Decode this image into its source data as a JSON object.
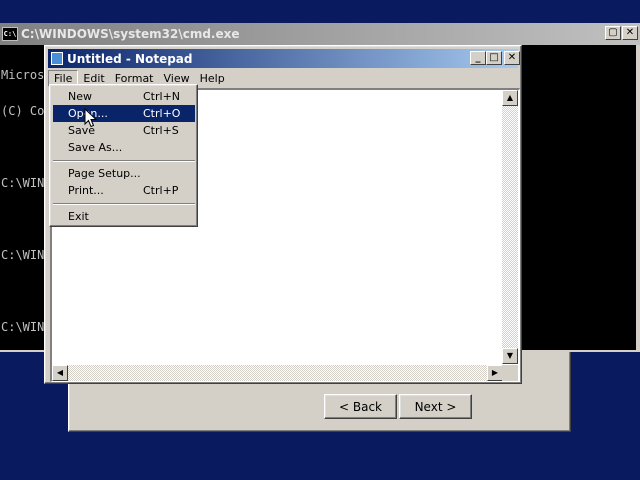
{
  "cmd_window": {
    "title": "C:\\WINDOWS\\system32\\cmd.exe",
    "icon": "cmd-icon",
    "icon_text": "C:\\",
    "console_lines": [
      "Micros",
      "(C) Co",
      "",
      "C:\\WIN",
      "",
      "C:\\WIN",
      "",
      "C:\\WIN"
    ]
  },
  "wizard": {
    "back_label": "< Back",
    "next_label": "Next >"
  },
  "notepad": {
    "title": "Untitled - Notepad",
    "menu": [
      "File",
      "Edit",
      "Format",
      "View",
      "Help"
    ],
    "content": ""
  },
  "file_menu": {
    "items": [
      {
        "label": "New",
        "shortcut": "Ctrl+N"
      },
      {
        "label": "Open...",
        "shortcut": "Ctrl+O"
      },
      {
        "label": "Save",
        "shortcut": "Ctrl+S"
      },
      {
        "label": "Save As...",
        "shortcut": ""
      },
      {
        "label": "Page Setup...",
        "shortcut": ""
      },
      {
        "label": "Print...",
        "shortcut": "Ctrl+P"
      },
      {
        "label": "Exit",
        "shortcut": ""
      }
    ],
    "selected_index": 1
  },
  "colors": {
    "desktop": "#0a1a5e",
    "active_title": "#0a246a",
    "inactive_title": "#808080",
    "menu_highlight": "#0a246a",
    "face": "#d4d0c8"
  }
}
